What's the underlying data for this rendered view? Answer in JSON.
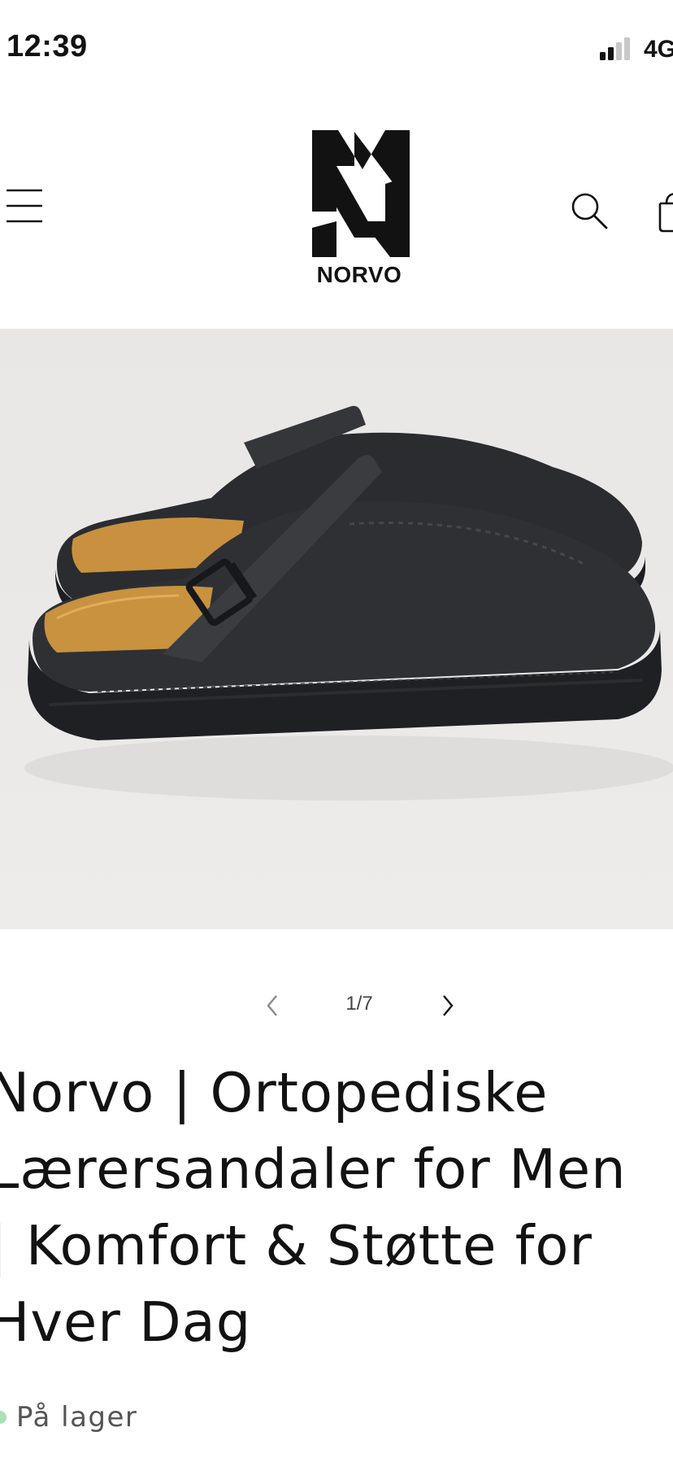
{
  "status_bar": {
    "time": "12:39",
    "network": "4G",
    "signal_icon": "cellular-signal-icon"
  },
  "header": {
    "menu_icon": "hamburger-menu-icon",
    "logo_text": "NORVO",
    "search_icon": "search-icon",
    "cart_icon": "shopping-bag-icon"
  },
  "product": {
    "image_icon": "product-photo",
    "slider": {
      "counter": "1/7",
      "current": 1,
      "total": 7,
      "prev_icon": "chevron-left-icon",
      "next_icon": "chevron-right-icon"
    },
    "title": "Norvo | Ortopediske\nLærersandaler for Men\n| Komfort & Støtte for\nHver Dag",
    "stock": {
      "label": "På lager",
      "color": "#a8e2b3"
    }
  },
  "colors": {
    "text": "#121212",
    "background": "#ffffff",
    "image_background": "#ebe9e8"
  }
}
